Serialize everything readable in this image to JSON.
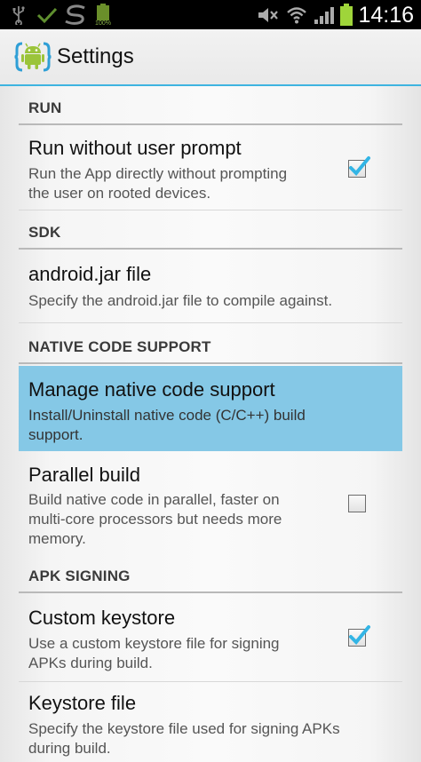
{
  "status_bar": {
    "time": "14:16",
    "battery_badge": "100%",
    "icons": [
      "usb-icon",
      "check-icon",
      "s-logo-icon",
      "battery-small-icon",
      "mute-icon",
      "wifi-icon",
      "signal-icon",
      "battery-icon"
    ]
  },
  "action_bar": {
    "title": "Settings",
    "icon": "android-code-icon"
  },
  "categories": {
    "run": "RUN",
    "sdk": "SDK",
    "native": "NATIVE CODE SUPPORT",
    "apk": "APK SIGNING"
  },
  "prefs": {
    "run_without_prompt": {
      "title": "Run without user prompt",
      "summary_1": "Run the App directly without prompting",
      "summary_2": "the user on rooted devices.",
      "checked": true
    },
    "android_jar": {
      "title": "android.jar file",
      "summary_1": "Specify the android.jar file to compile against."
    },
    "manage_native": {
      "title": "Manage native code support",
      "summary_1": "Install/Uninstall native code (C/C++) build",
      "summary_2": "support."
    },
    "parallel_build": {
      "title": "Parallel build",
      "summary_1": "Build native code in parallel, faster on",
      "summary_2": "multi-core processors but needs more",
      "summary_3": "memory.",
      "checked": false
    },
    "custom_keystore": {
      "title": "Custom keystore",
      "summary_1": "Use a custom keystore file for signing",
      "summary_2": "APKs during build.",
      "checked": true
    },
    "keystore_file": {
      "title": "Keystore file",
      "summary_1": "Specify the keystore file used for signing APKs",
      "summary_2": "during build."
    }
  },
  "colors": {
    "accent": "#3eb4e0",
    "selected_bg": "#85c8e6",
    "check": "#33b5e5"
  }
}
